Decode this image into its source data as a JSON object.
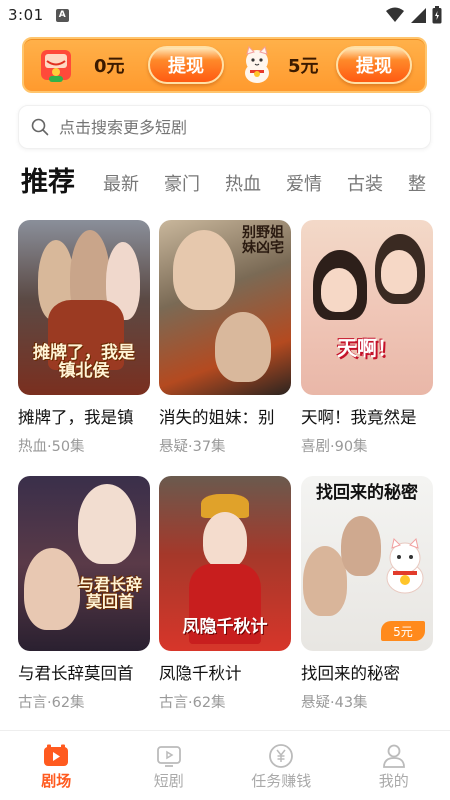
{
  "status_bar": {
    "time": "3:01",
    "app_icon_letter": "A"
  },
  "reward_banner": {
    "cash_amount": "0元",
    "cash_withdraw_label": "提现",
    "coin_amount": "5元",
    "coin_withdraw_label": "提现"
  },
  "search": {
    "placeholder": "点击搜索更多短剧"
  },
  "tabs": [
    {
      "label": "推荐",
      "active": true
    },
    {
      "label": "最新"
    },
    {
      "label": "豪门"
    },
    {
      "label": "热血"
    },
    {
      "label": "爱情"
    },
    {
      "label": "古装"
    },
    {
      "label": "整"
    }
  ],
  "dramas": [
    {
      "title": "摊牌了，我是镇",
      "meta": "热血·50集",
      "poster_text": "摊牌了，我是镇北侯"
    },
    {
      "title": "消失的姐妹：别",
      "meta": "悬疑·37集",
      "poster_text": "别野姐妹凶宅"
    },
    {
      "title": "天啊！我竟然是",
      "meta": "喜剧·90集",
      "poster_text": "天啊！"
    },
    {
      "title": "与君长辞莫回首",
      "meta": "古言·62集",
      "poster_text": "与君长辞莫回首"
    },
    {
      "title": "凤隐千秋计",
      "meta": "古言·62集",
      "poster_text": "凤隐千秋计"
    },
    {
      "title": "找回来的秘密",
      "meta": "悬疑·43集",
      "poster_text": "找回来的秘密",
      "reward_tag": "5元"
    }
  ],
  "bottom_nav": [
    {
      "label": "剧场",
      "icon": "theater-icon",
      "active": true
    },
    {
      "label": "短剧",
      "icon": "tv-icon"
    },
    {
      "label": "任务赚钱",
      "icon": "yen-coin-icon"
    },
    {
      "label": "我的",
      "icon": "profile-icon"
    }
  ],
  "colors": {
    "accent": "#ff5a1f",
    "banner": "#ff9a2e",
    "muted_text": "#999999"
  }
}
